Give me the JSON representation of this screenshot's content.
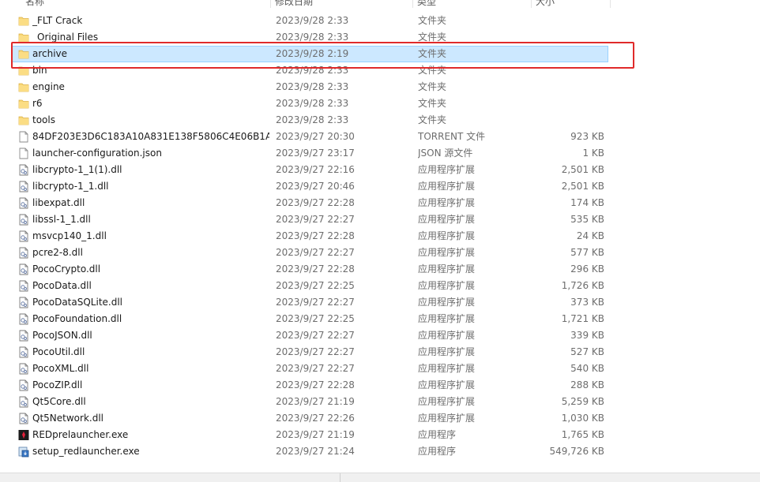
{
  "columns": {
    "name": "名称",
    "date": "修改日期",
    "type": "类型",
    "size": "大小"
  },
  "selected_index": 2,
  "files": [
    {
      "name": "_FLT Crack",
      "date": "2023/9/28 2:33",
      "type": "文件夹",
      "size": "",
      "icon": "folder-icon"
    },
    {
      "name": "_Original Files",
      "date": "2023/9/28 2:33",
      "type": "文件夹",
      "size": "",
      "icon": "folder-icon"
    },
    {
      "name": "archive",
      "date": "2023/9/28 2:19",
      "type": "文件夹",
      "size": "",
      "icon": "folder-icon"
    },
    {
      "name": "bin",
      "date": "2023/9/28 2:33",
      "type": "文件夹",
      "size": "",
      "icon": "folder-icon"
    },
    {
      "name": "engine",
      "date": "2023/9/28 2:33",
      "type": "文件夹",
      "size": "",
      "icon": "folder-icon"
    },
    {
      "name": "r6",
      "date": "2023/9/28 2:33",
      "type": "文件夹",
      "size": "",
      "icon": "folder-icon"
    },
    {
      "name": "tools",
      "date": "2023/9/28 2:33",
      "type": "文件夹",
      "size": "",
      "icon": "folder-icon"
    },
    {
      "name": "84DF203E3D6C183A10A831E138F5806C4E06B1A...",
      "date": "2023/9/27 20:30",
      "type": "TORRENT 文件",
      "size": "923 KB",
      "icon": "generic-file-icon"
    },
    {
      "name": "launcher-configuration.json",
      "date": "2023/9/27 23:17",
      "type": "JSON 源文件",
      "size": "1 KB",
      "icon": "generic-file-icon"
    },
    {
      "name": "libcrypto-1_1(1).dll",
      "date": "2023/9/27 22:16",
      "type": "应用程序扩展",
      "size": "2,501 KB",
      "icon": "dll-file-icon"
    },
    {
      "name": "libcrypto-1_1.dll",
      "date": "2023/9/27 20:46",
      "type": "应用程序扩展",
      "size": "2,501 KB",
      "icon": "dll-file-icon"
    },
    {
      "name": "libexpat.dll",
      "date": "2023/9/27 22:28",
      "type": "应用程序扩展",
      "size": "174 KB",
      "icon": "dll-file-icon"
    },
    {
      "name": "libssl-1_1.dll",
      "date": "2023/9/27 22:27",
      "type": "应用程序扩展",
      "size": "535 KB",
      "icon": "dll-file-icon"
    },
    {
      "name": "msvcp140_1.dll",
      "date": "2023/9/27 22:28",
      "type": "应用程序扩展",
      "size": "24 KB",
      "icon": "dll-file-icon"
    },
    {
      "name": "pcre2-8.dll",
      "date": "2023/9/27 22:27",
      "type": "应用程序扩展",
      "size": "577 KB",
      "icon": "dll-file-icon"
    },
    {
      "name": "PocoCrypto.dll",
      "date": "2023/9/27 22:28",
      "type": "应用程序扩展",
      "size": "296 KB",
      "icon": "dll-file-icon"
    },
    {
      "name": "PocoData.dll",
      "date": "2023/9/27 22:25",
      "type": "应用程序扩展",
      "size": "1,726 KB",
      "icon": "dll-file-icon"
    },
    {
      "name": "PocoDataSQLite.dll",
      "date": "2023/9/27 22:27",
      "type": "应用程序扩展",
      "size": "373 KB",
      "icon": "dll-file-icon"
    },
    {
      "name": "PocoFoundation.dll",
      "date": "2023/9/27 22:25",
      "type": "应用程序扩展",
      "size": "1,721 KB",
      "icon": "dll-file-icon"
    },
    {
      "name": "PocoJSON.dll",
      "date": "2023/9/27 22:27",
      "type": "应用程序扩展",
      "size": "339 KB",
      "icon": "dll-file-icon"
    },
    {
      "name": "PocoUtil.dll",
      "date": "2023/9/27 22:27",
      "type": "应用程序扩展",
      "size": "527 KB",
      "icon": "dll-file-icon"
    },
    {
      "name": "PocoXML.dll",
      "date": "2023/9/27 22:27",
      "type": "应用程序扩展",
      "size": "540 KB",
      "icon": "dll-file-icon"
    },
    {
      "name": "PocoZIP.dll",
      "date": "2023/9/27 22:28",
      "type": "应用程序扩展",
      "size": "288 KB",
      "icon": "dll-file-icon"
    },
    {
      "name": "Qt5Core.dll",
      "date": "2023/9/27 21:19",
      "type": "应用程序扩展",
      "size": "5,259 KB",
      "icon": "dll-file-icon"
    },
    {
      "name": "Qt5Network.dll",
      "date": "2023/9/27 22:26",
      "type": "应用程序扩展",
      "size": "1,030 KB",
      "icon": "dll-file-icon"
    },
    {
      "name": "REDprelauncher.exe",
      "date": "2023/9/27 21:19",
      "type": "应用程序",
      "size": "1,765 KB",
      "icon": "red-app-icon"
    },
    {
      "name": "setup_redlauncher.exe",
      "date": "2023/9/27 21:24",
      "type": "应用程序",
      "size": "549,726 KB",
      "icon": "installer-icon"
    }
  ],
  "colors": {
    "selection_bg": "#cce8ff",
    "selection_border": "#99d1ff",
    "annotation_box": "#e02a2a",
    "folder": "#f8d775"
  }
}
